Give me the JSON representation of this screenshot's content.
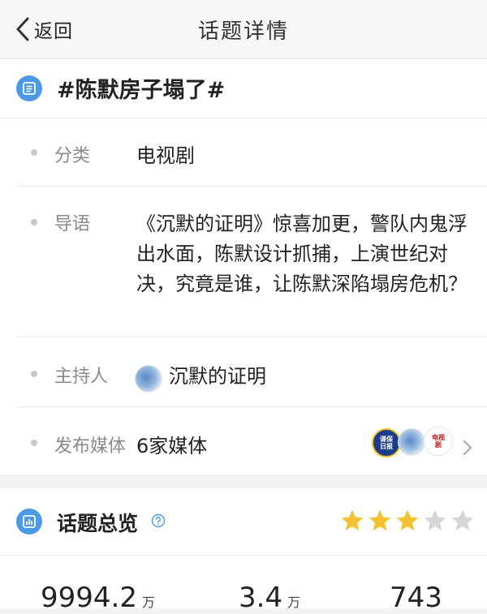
{
  "nav": {
    "back_label": "返回",
    "title": "话题详情"
  },
  "topic": {
    "title": "#陈默房子塌了#"
  },
  "details": {
    "category_label": "分类",
    "category_value": "电视剧",
    "intro_label": "导语",
    "intro_value": "《沉默的证明》惊喜加更，警队内鬼浮出水面，陈默设计抓捕，上演世纪对决，究竟是谁，让陈默深陷塌房危机？",
    "host_label": "主持人",
    "host_value": "沉默的证明",
    "media_label": "发布媒体",
    "media_value": "6家媒体",
    "media_logos": [
      "媒体logo-1",
      "媒体logo-2",
      "媒体logo-3"
    ]
  },
  "overview": {
    "title": "话题总览",
    "rating_stars": 3,
    "rating_max": 5,
    "star_on_color": "#f2c230",
    "star_off_color": "#d6d6d6",
    "stats": [
      {
        "value": "9994.2",
        "unit": "万"
      },
      {
        "value": "3.4",
        "unit": "万"
      },
      {
        "value": "743",
        "unit": ""
      }
    ]
  },
  "colors": {
    "accent": "#4a9ae8"
  }
}
